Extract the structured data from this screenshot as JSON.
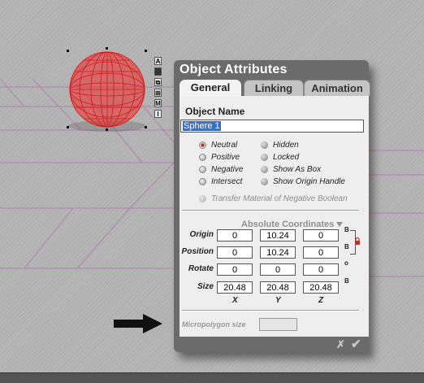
{
  "dialog": {
    "title": "Object Attributes",
    "tabs": [
      {
        "label": "General",
        "active": true
      },
      {
        "label": "Linking",
        "active": false
      },
      {
        "label": "Animation",
        "active": false
      }
    ],
    "object_name": {
      "label": "Object Name",
      "value": "Sphere 1"
    },
    "boolean_modes": [
      {
        "label": "Neutral",
        "selected": true
      },
      {
        "label": "Positive",
        "selected": false
      },
      {
        "label": "Negative",
        "selected": false
      },
      {
        "label": "Intersect",
        "selected": false
      }
    ],
    "display_options": [
      {
        "label": "Hidden",
        "checked": false
      },
      {
        "label": "Locked",
        "checked": false
      },
      {
        "label": "Show As Box",
        "checked": false
      },
      {
        "label": "Show Origin Handle",
        "checked": false
      }
    ],
    "transfer_material": {
      "label": "Transfer Material of Negative Boolean",
      "enabled": false
    },
    "coordinates": {
      "header": "Absolute Coordinates",
      "rows": [
        {
          "label": "Origin",
          "values": [
            "0",
            "10.24",
            "0"
          ],
          "marker": "B"
        },
        {
          "label": "Position",
          "values": [
            "0",
            "10.24",
            "0"
          ],
          "marker": "B"
        },
        {
          "label": "Rotate",
          "values": [
            "0",
            "0",
            "0"
          ],
          "marker": "o"
        },
        {
          "label": "Size",
          "values": [
            "20.48",
            "20.48",
            "20.48"
          ],
          "marker": "B"
        }
      ],
      "axes": [
        "X",
        "Y",
        "Z"
      ]
    },
    "micropolygon": {
      "label": "Micropolygon size",
      "value": ""
    },
    "footer": {
      "cancel": "✗",
      "ok": "✔"
    }
  },
  "object_tools": [
    "A",
    "",
    "⧉",
    "⊞",
    "M",
    "I"
  ],
  "colors": {
    "wireframe": "#e02020",
    "ground_grid": "#b070b0",
    "accent_lock": "#c0302a"
  }
}
